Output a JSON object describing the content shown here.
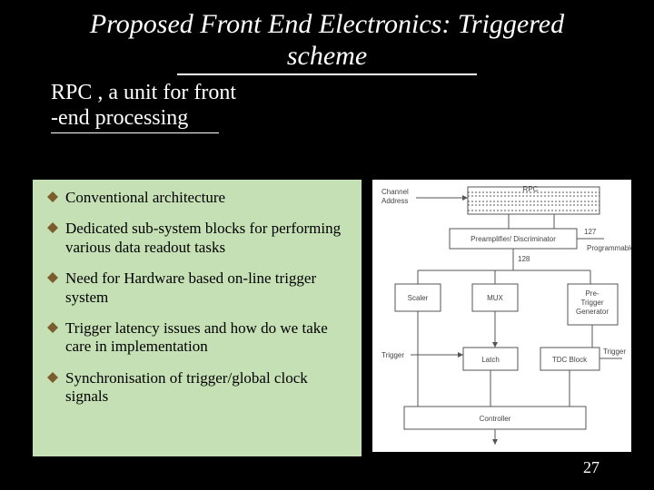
{
  "title": "Proposed Front End Electronics: Triggered scheme",
  "subtitle_line1": "RPC , a unit for front",
  "subtitle_line2": "-end processing",
  "bullets": [
    "Conventional architecture",
    "Dedicated sub-system blocks for performing various data readout tasks",
    "Need for Hardware based on-line trigger system",
    "Trigger latency issues and how do we take care in implementation",
    "Synchronisation of  trigger/global clock signals"
  ],
  "diagram": {
    "channel_address": "Channel\nAddress",
    "rpc": "RPC",
    "preamp": "Preamplifier/ Discriminator",
    "count128": "128",
    "count127": "127",
    "programmable": "Programmable",
    "scaler": "Scaler",
    "mux": "MUX",
    "pretrigger": "Pre-\nTrigger\nGenerator",
    "trigger": "Trigger",
    "latch": "Latch",
    "tdc": "TDC Block",
    "controller": "Controller"
  },
  "page_number": "27",
  "colors": {
    "bg": "#000000",
    "panel": "#c5e0b4",
    "bullet_fill": "#8a6d3b"
  }
}
